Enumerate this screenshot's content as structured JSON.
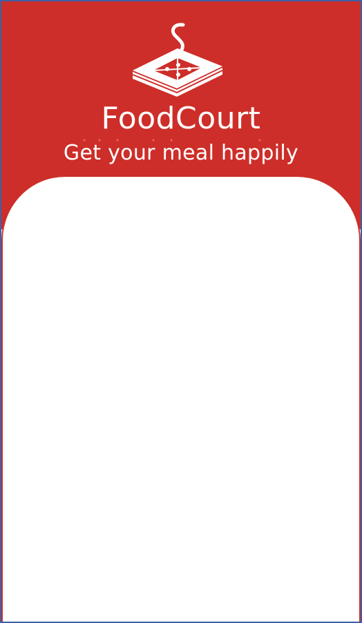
{
  "app": {
    "title": "FoodCourt",
    "tagline": "Get your meal happily"
  },
  "logo": {
    "icon": "pizza-box-with-steam-icon"
  },
  "colors": {
    "brand_red": "#cd2e29",
    "window_border": "#3f5fa8",
    "card_background": "#ffffff"
  }
}
